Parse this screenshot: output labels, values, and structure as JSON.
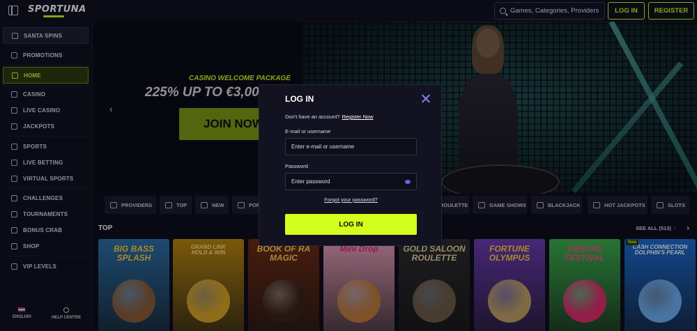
{
  "header": {
    "logo": "SPORTUNA",
    "search_placeholder": "Games, Categories, Providers",
    "login_label": "LOG IN",
    "register_label": "REGISTER"
  },
  "sidebar": {
    "items": [
      {
        "label": "SANTA SPINS",
        "icon": "snowflake-icon"
      },
      {
        "label": "PROMOTIONS",
        "icon": "gift-icon"
      },
      {
        "label": "HOME",
        "icon": "home-icon",
        "active": true
      },
      {
        "label": "CASINO",
        "icon": "cards-icon"
      },
      {
        "label": "LIVE CASINO",
        "icon": "phone-icon"
      },
      {
        "label": "JACKPOTS",
        "icon": "rocket-icon"
      },
      {
        "label": "SPORTS",
        "icon": "ball-icon"
      },
      {
        "label": "LIVE BETTING",
        "icon": "video-icon"
      },
      {
        "label": "VIRTUAL SPORTS",
        "icon": "gamepad-icon"
      },
      {
        "label": "CHALLENGES",
        "icon": "target-icon"
      },
      {
        "label": "TOURNAMENTS",
        "icon": "trophy-icon"
      },
      {
        "label": "BONUS CRAB",
        "icon": "crab-icon"
      },
      {
        "label": "SHOP",
        "icon": "bag-icon"
      },
      {
        "label": "VIP LEVELS",
        "icon": "diamond-icon"
      }
    ],
    "language": "ENGLISH",
    "help": "HELP CENTRE"
  },
  "hero": {
    "subtitle": "CASINO WELCOME PACKAGE",
    "title": "225% UP TO €3,00",
    "cta": "JOIN NOW"
  },
  "categories": [
    {
      "label": "PROVIDERS",
      "icon": "layers-icon"
    },
    {
      "label": "TOP",
      "icon": "crown-icon"
    },
    {
      "label": "NEW",
      "icon": "bolt-icon"
    },
    {
      "label": "POP",
      "icon": "drop-icon"
    },
    {
      "label": "ROULETTE",
      "icon": "roulette-icon"
    },
    {
      "label": "GAME SHOWS",
      "icon": "mic-icon"
    },
    {
      "label": "BLACKJACK",
      "icon": "blackjack-icon"
    },
    {
      "label": "HOT JACKPOTS",
      "icon": "flame-icon"
    },
    {
      "label": "SLOTS",
      "icon": "slots-icon"
    }
  ],
  "top_section": {
    "title": "TOP",
    "see_all": "SEE ALL (513)",
    "games": [
      {
        "name": "BIG BASS\nSPLASH",
        "bg": "#2a6fa6",
        "fg": "#ffd23a",
        "art": "#8a5a34"
      },
      {
        "name": "GRAND LINK\nHOLD & WIN",
        "bg": "#b8860b",
        "fg": "#ffe27a",
        "art": "#d9a520"
      },
      {
        "name": "BOOK OF RA\nMAGIC",
        "bg": "#6b2a10",
        "fg": "#ffcc55",
        "art": "#3a2014"
      },
      {
        "name": "Mini Drop",
        "bg": "#e8a0b8",
        "fg": "#d62a7a",
        "art": "#c07a3a"
      },
      {
        "name": "GOLD SALOON\nROULETTE",
        "bg": "#2a2a2a",
        "fg": "#e8d6a0",
        "art": "#6a5a40"
      },
      {
        "name": "FORTUNE\nOLYMPUS",
        "bg": "#6a3ab0",
        "fg": "#ffd23a",
        "art": "#c0a060"
      },
      {
        "name": "FIESTAS\nFESTIVAL",
        "bg": "#3ab04a",
        "fg": "#ff4a8a",
        "art": "#e02a6a"
      },
      {
        "name": "CASH CONNECTION\nDOLPHIN'S PEARL",
        "bg": "#1a6ad0",
        "fg": "#ffffff",
        "art": "#6ab0f0",
        "badge": "New"
      }
    ]
  },
  "modal": {
    "title": "LOG IN",
    "no_account_text": "Don't have an account?",
    "register_link": "Register Now",
    "email_label": "E-mail or username",
    "email_placeholder": "Enter e-mail or username",
    "password_label": "Password",
    "password_placeholder": "Enter password",
    "forgot": "Forgot your password?",
    "submit": "LOG IN"
  },
  "colors": {
    "accent": "#c8ff1e",
    "background": "#0b0b17",
    "close": "#8b82ff"
  }
}
